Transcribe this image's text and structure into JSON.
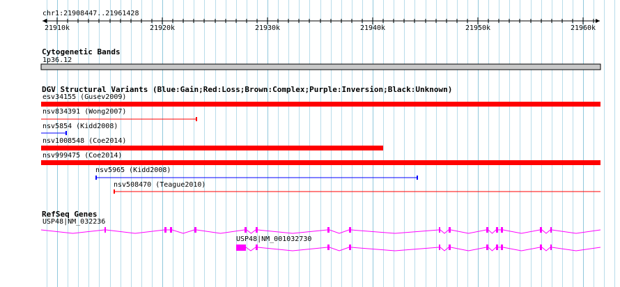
{
  "location": "chr1:21908447..21961428",
  "ruler": {
    "ticks": [
      "21910k",
      "21920k",
      "21930k",
      "21940k",
      "21950k",
      "21960k"
    ]
  },
  "cytoband": {
    "title": "Cytogenetic Bands",
    "band_label": "1p36.12",
    "color": "#c8c8c8"
  },
  "dgv": {
    "title": "DGV Structural Variants (Blue:Gain;Red:Loss;Brown:Complex;Purple:Inversion;Black:Unknown)",
    "colors": {
      "gain": "#0000ff",
      "loss": "#ff0000"
    },
    "features": [
      {
        "label": "esv34155 (Gusev2009)",
        "type": "loss",
        "style": "thick"
      },
      {
        "label": "nsv834391 (Wong2007)",
        "type": "loss",
        "style": "thin"
      },
      {
        "label": "nsv5854 (Kidd2008)",
        "type": "gain",
        "style": "thin"
      },
      {
        "label": "nsv1008548 (Coe2014)",
        "type": "loss",
        "style": "thick"
      },
      {
        "label": "nsv999475 (Coe2014)",
        "type": "loss",
        "style": "thick"
      },
      {
        "label": "nsv5965 (Kidd2008)",
        "type": "gain",
        "style": "thin"
      },
      {
        "label": "nsv508470 (Teague2010)",
        "type": "loss",
        "style": "thin"
      }
    ]
  },
  "refseq": {
    "title": "RefSeq Genes",
    "color": "#ff00ff",
    "genes": [
      {
        "label": "USP48|NM_032236"
      },
      {
        "label": "USP48|NM_001032730"
      }
    ]
  }
}
